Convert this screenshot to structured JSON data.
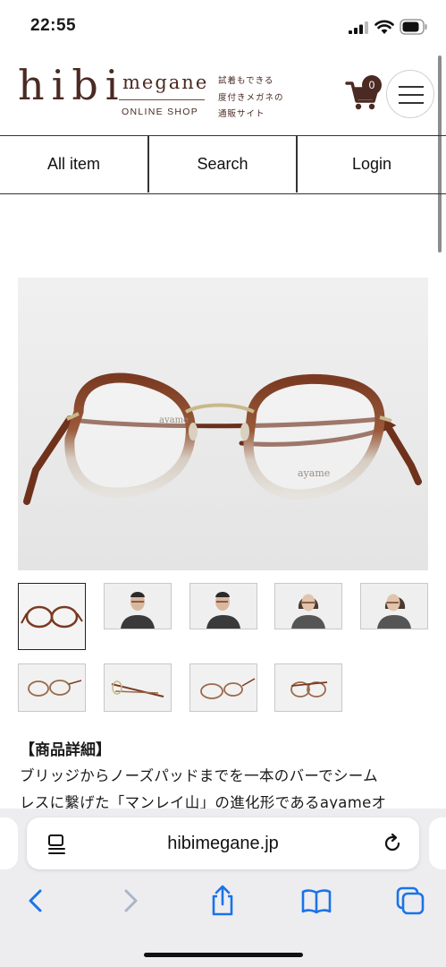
{
  "status_bar": {
    "time": "22:55"
  },
  "header": {
    "logo_main": "hibi",
    "logo_sub": "megane",
    "logo_shop": "ONLINE SHOP",
    "tagline": [
      "試着もできる",
      "度付きメガネの",
      "通販サイト"
    ],
    "cart_count": "0",
    "brand_color": "#4a2a22"
  },
  "nav": {
    "items": [
      "All item",
      "Search",
      "Login"
    ]
  },
  "product": {
    "main_image_brand_marks": [
      "ayame",
      "ayame"
    ],
    "thumbnails": [
      {
        "kind": "glasses-front",
        "selected": true
      },
      {
        "kind": "model-man-front",
        "selected": false
      },
      {
        "kind": "model-man-side",
        "selected": false
      },
      {
        "kind": "model-woman-front",
        "selected": false
      },
      {
        "kind": "model-woman-side",
        "selected": false
      },
      {
        "kind": "glasses-angle",
        "selected": false
      },
      {
        "kind": "glasses-side",
        "selected": false
      },
      {
        "kind": "glasses-tilt",
        "selected": false
      },
      {
        "kind": "glasses-folded",
        "selected": false
      }
    ],
    "detail_title": "【商品詳細】",
    "detail_lines": [
      "ブリッジからノーズパッドまでを一本のバーでシーム",
      "レスに繋げた「マンレイ山」の進化形であるayameオ"
    ]
  },
  "browser": {
    "url": "hibimegane.jp"
  },
  "colors": {
    "frame_brown": "#7a3a22",
    "metal_gold": "#c9b88a"
  }
}
